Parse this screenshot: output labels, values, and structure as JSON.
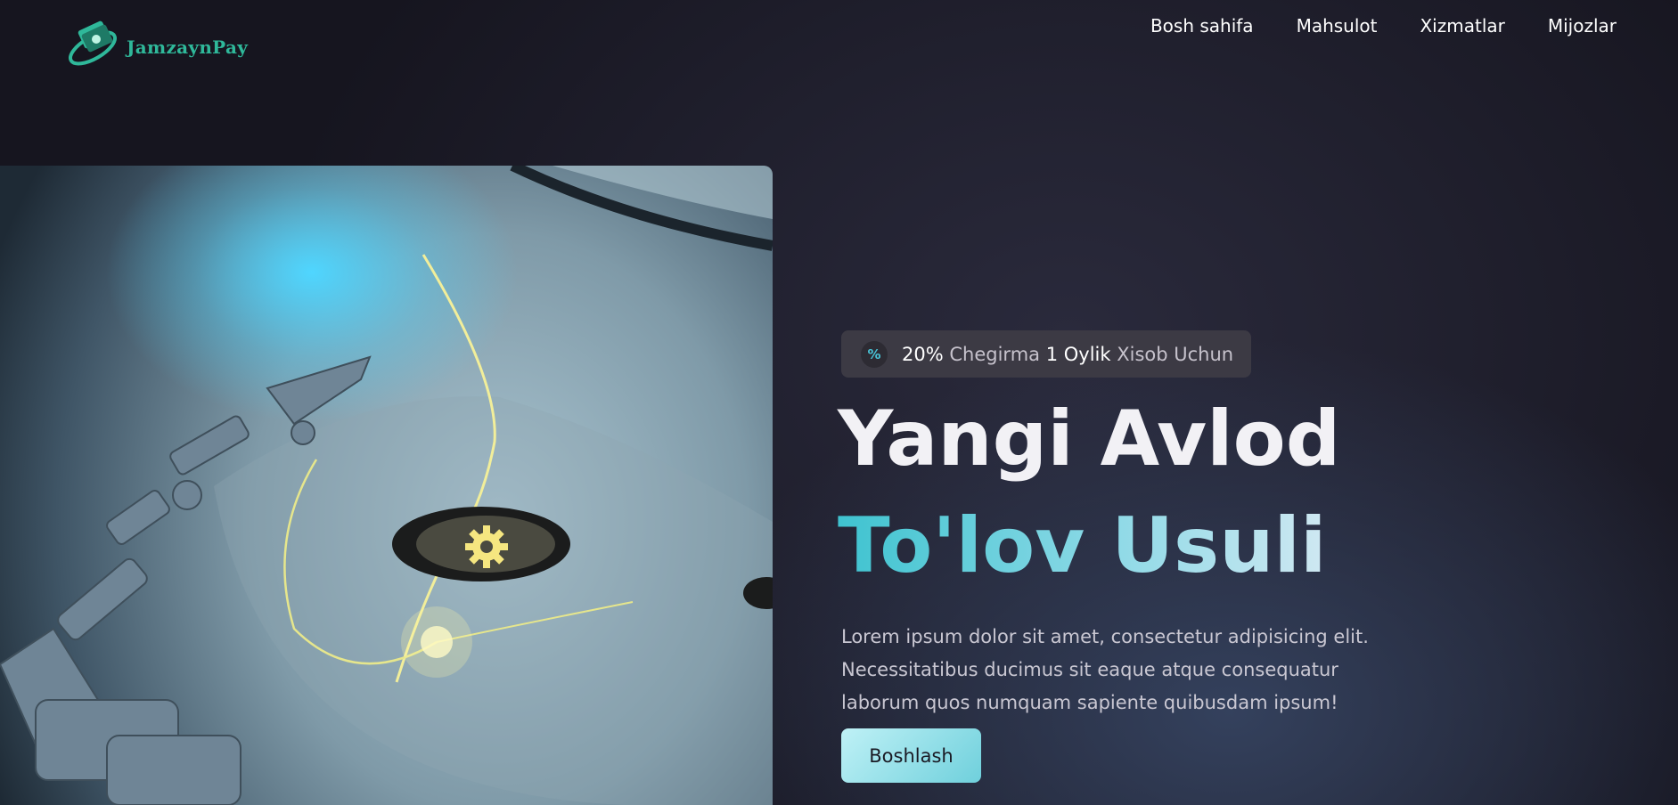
{
  "brand": {
    "name": "JamzaynPay",
    "accent": "#2fb89a"
  },
  "nav": {
    "items": [
      {
        "label": "Bosh sahifa"
      },
      {
        "label": "Mahsulot"
      },
      {
        "label": "Xizmatlar"
      },
      {
        "label": "Mijozlar"
      }
    ]
  },
  "hero": {
    "image_icon": "gear-icon",
    "promo": {
      "icon": "percent-icon",
      "icon_glyph": "%",
      "percent": "20%",
      "text1": "Chegirma",
      "highlight": "1 Oylik",
      "text2": "Xisob Uchun"
    },
    "title_line1": "Yangi Avlod",
    "title_line2": "To'lov Usuli",
    "description": "Lorem ipsum dolor sit amet, consectetur adipisicing elit. Necessitatibus ducimus sit eaque atque consequatur laborum quos numquam sapiente quibusdam ipsum!",
    "cta_label": "Boshlash"
  },
  "colors": {
    "background": "#16151f",
    "title_gradient_start": "#3fc3d0",
    "cta": "#8fdfe8"
  }
}
